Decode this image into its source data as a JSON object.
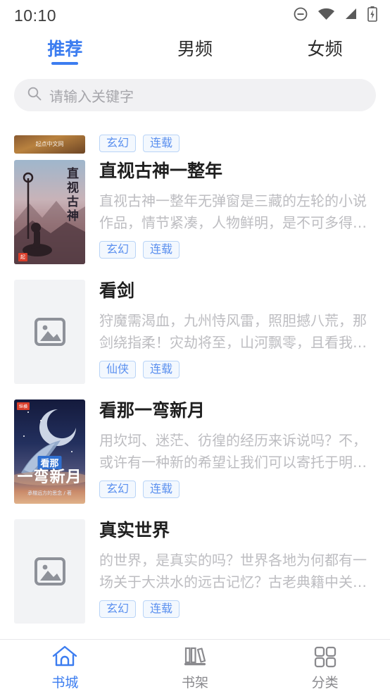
{
  "status_bar": {
    "time": "10:10",
    "icons": [
      "do-not-disturb-icon",
      "wifi-icon",
      "cellular-signal-icon",
      "battery-charging-icon"
    ]
  },
  "tabs": [
    {
      "label": "推荐",
      "active": true
    },
    {
      "label": "男频",
      "active": false
    },
    {
      "label": "女频",
      "active": false
    }
  ],
  "search": {
    "placeholder": "请输入关键字",
    "value": "",
    "icon": "search-icon"
  },
  "books": [
    {
      "title": "",
      "desc": "",
      "tags": [
        "玄幻",
        "连载"
      ],
      "cover_type": "image",
      "cover_label": "起点中文网",
      "partial": true
    },
    {
      "title": "直视古神一整年",
      "desc": "直视古神一整年无弹窗是三藏的左轮的小说作品，情节紧凑，人物鲜明，是不可多得…",
      "tags": [
        "玄幻",
        "连载"
      ],
      "cover_type": "image",
      "cover_label": "直视古神",
      "partial": false
    },
    {
      "title": "看剑",
      "desc": "狩魔需渴血，九州恃风雷，照胆撼八荒，那剑绕指柔！灾劫将至，山河飘零，且看我…",
      "tags": [
        "仙侠",
        "连载"
      ],
      "cover_type": "placeholder",
      "cover_label": "",
      "partial": false
    },
    {
      "title": "看那一弯新月",
      "desc": "用坎坷、迷茫、彷徨的经历来诉说吗？不，或许有一种新的希望让我们可以寄托于明…",
      "tags": [
        "玄幻",
        "连载"
      ],
      "cover_type": "image",
      "cover_label": "看那一弯新月",
      "partial": false
    },
    {
      "title": "真实世界",
      "desc": "的世界，是真实的吗？世界各地为何都有一场关于大洪水的远古记忆？古老典籍中关…",
      "tags": [
        "玄幻",
        "连载"
      ],
      "cover_type": "placeholder",
      "cover_label": "",
      "partial": false
    }
  ],
  "bottom_nav": [
    {
      "label": "书城",
      "icon": "home-icon",
      "active": true
    },
    {
      "label": "书架",
      "icon": "bookshelf-icon",
      "active": false
    },
    {
      "label": "分类",
      "icon": "grid-icon",
      "active": false
    }
  ],
  "colors": {
    "accent": "#3c7df0",
    "tag_text": "#5b90ef",
    "tag_border": "#b9d4f7",
    "tag_bg": "#f3f8fe",
    "title": "#1f1f1f",
    "desc": "#bdbdc1",
    "search_bg": "#f1f1f3",
    "nav_inactive": "#8a8a8e"
  }
}
